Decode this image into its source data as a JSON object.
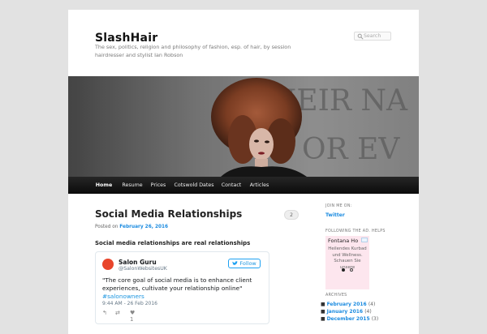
{
  "site": {
    "title": "SlashHair",
    "description": "The sex, politics, religion and philosophy of fashion, esp. of hair, by session hairdresser and stylist Ian Robson"
  },
  "search": {
    "placeholder": "Search"
  },
  "header_image": {
    "background_text_line1": "HEIR NA",
    "background_text_line2": "OR EV"
  },
  "nav": {
    "items": [
      {
        "label": "Home"
      },
      {
        "label": "Resume"
      },
      {
        "label": "Prices"
      },
      {
        "label": "Cotswold Dates"
      },
      {
        "label": "Contact"
      },
      {
        "label": "Articles"
      }
    ]
  },
  "post": {
    "title": "Social Media Relationships",
    "comment_count": "2",
    "posted_on_label": "Posted on",
    "date": "February 26, 2016",
    "lead": "Social media relationships are real relationships"
  },
  "tweet": {
    "name": "Salon Guru",
    "handle": "@SalonWebsitesUK",
    "follow_label": "Follow",
    "text": "\"The core goal of social media is to enhance client experiences, cultivate your relationship online\"",
    "hashtag": "#salonowners",
    "time": "9:44 AM - 26 Feb 2016",
    "like_count": "1"
  },
  "sidebar": {
    "join_heading": "JOIN ME ON:",
    "twitter_link": "Twitter",
    "ad_heading": "FOLLOWING THE AD. HELPS",
    "ad_title": "Fontana Ho",
    "ad_text_line1": "Heilendes Kurbad",
    "ad_text_line2": "und Wellness.",
    "ad_text_line3": "Schauen Sie",
    "ad_text_line4": "unsere",
    "archives_heading": "ARCHIVES",
    "archives": [
      {
        "label": "February 2016",
        "count": "(4)"
      },
      {
        "label": "January 2016",
        "count": "(4)"
      },
      {
        "label": "December 2015",
        "count": "(3)"
      }
    ]
  },
  "colors": {
    "link": "#1b8be0",
    "nav_bg": "#111111",
    "page_bg": "#e2e2e2"
  }
}
